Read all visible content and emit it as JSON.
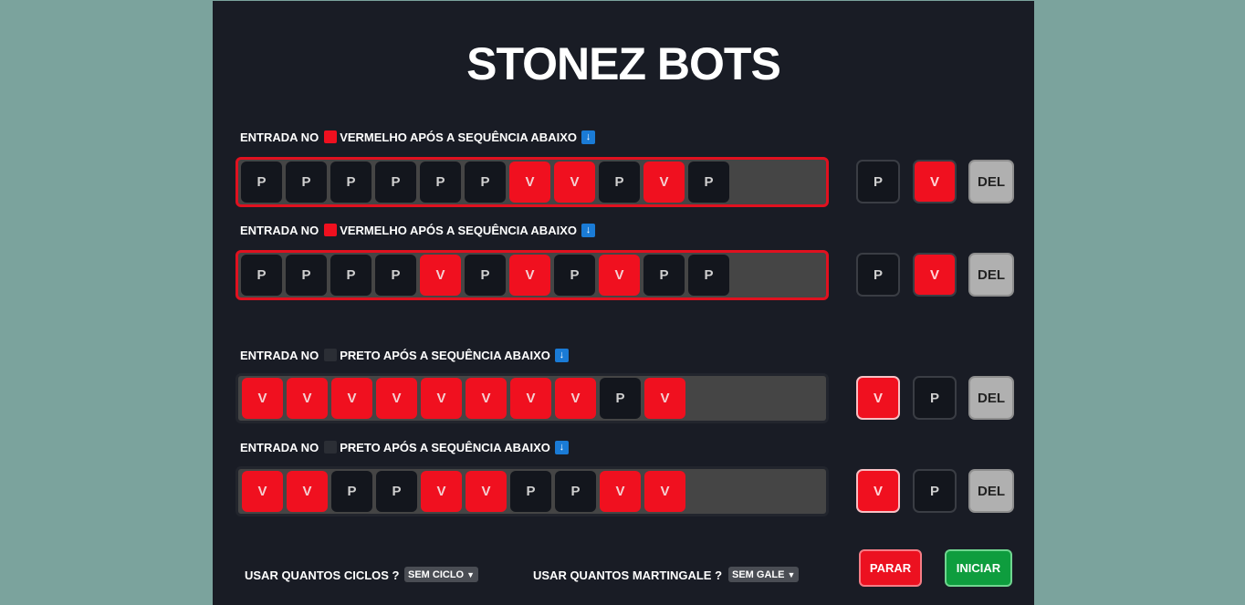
{
  "app": {
    "title": "STONEZ BOTS"
  },
  "colors": {
    "red": "#f0101f",
    "black": "#13161d",
    "background": "#191c25",
    "start": "#0e9d3e"
  },
  "rows": [
    {
      "prefix": "ENTRADA NO",
      "color_name": "red",
      "label_rest": "VERMELHO APÓS A SEQUÊNCIA ABAIXO",
      "arrow_icon": "↓",
      "sequence": [
        "P",
        "P",
        "P",
        "P",
        "P",
        "P",
        "V",
        "V",
        "P",
        "V",
        "P"
      ],
      "buttons": [
        "P",
        "V",
        "DEL"
      ]
    },
    {
      "prefix": "ENTRADA NO",
      "color_name": "red",
      "label_rest": "VERMELHO APÓS A SEQUÊNCIA ABAIXO",
      "arrow_icon": "↓",
      "sequence": [
        "P",
        "P",
        "P",
        "P",
        "V",
        "P",
        "V",
        "P",
        "V",
        "P",
        "P"
      ],
      "buttons": [
        "P",
        "V",
        "DEL"
      ]
    },
    {
      "prefix": "ENTRADA NO",
      "color_name": "black",
      "label_rest": "PRETO APÓS A SEQUÊNCIA ABAIXO",
      "arrow_icon": "↓",
      "sequence": [
        "V",
        "V",
        "V",
        "V",
        "V",
        "V",
        "V",
        "V",
        "P",
        "V"
      ],
      "buttons": [
        "V",
        "P",
        "DEL"
      ]
    },
    {
      "prefix": "ENTRADA NO",
      "color_name": "black",
      "label_rest": "PRETO APÓS A SEQUÊNCIA ABAIXO",
      "arrow_icon": "↓",
      "sequence": [
        "V",
        "V",
        "P",
        "P",
        "V",
        "V",
        "P",
        "P",
        "V",
        "V"
      ],
      "buttons": [
        "V",
        "P",
        "DEL"
      ]
    }
  ],
  "footer": {
    "cycles_label": "USAR QUANTOS CICLOS ?",
    "cycles_value": "SEM CICLO",
    "martingale_label": "USAR QUANTOS MARTINGALE ?",
    "martingale_value": "SEM GALE",
    "stop_label": "PARAR",
    "start_label": "INICIAR"
  }
}
